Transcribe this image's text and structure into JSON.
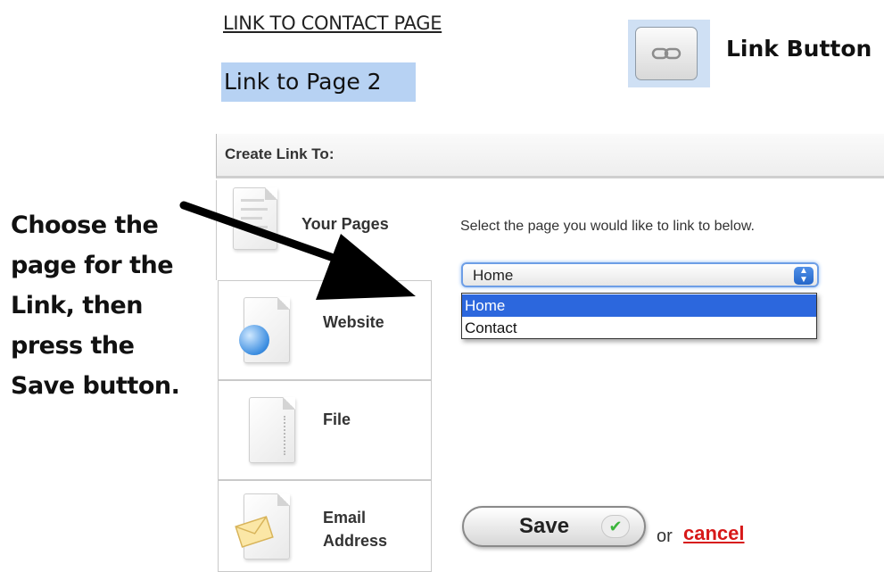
{
  "editor": {
    "contact_link_text": "LINK TO CONTACT PAGE",
    "selected_text": "Link to Page 2",
    "link_button_callout": "Link Button"
  },
  "dialog": {
    "header": "Create Link To:",
    "tabs": [
      {
        "label": "Your Pages",
        "icon": "page-document-icon"
      },
      {
        "label": "Website",
        "icon": "globe-document-icon"
      },
      {
        "label": "File",
        "icon": "file-document-icon"
      },
      {
        "label_line1": "Email",
        "label_line2": "Address",
        "icon": "envelope-document-icon"
      }
    ],
    "instruction": "Select the page you would like to link to below.",
    "select": {
      "value": "Home",
      "options": [
        "Home",
        "Contact"
      ],
      "highlighted": "Home"
    },
    "save_label": "Save",
    "or_text": "or",
    "cancel_label": "cancel"
  },
  "annotation": {
    "lines": [
      "Choose the",
      "page for the",
      "Link, then",
      "press the",
      "Save button."
    ]
  },
  "colors": {
    "selection_highlight": "#b7d2f3",
    "option_highlight": "#2c67dd",
    "cancel_red": "#d71919",
    "check_green": "#3cb53c"
  }
}
